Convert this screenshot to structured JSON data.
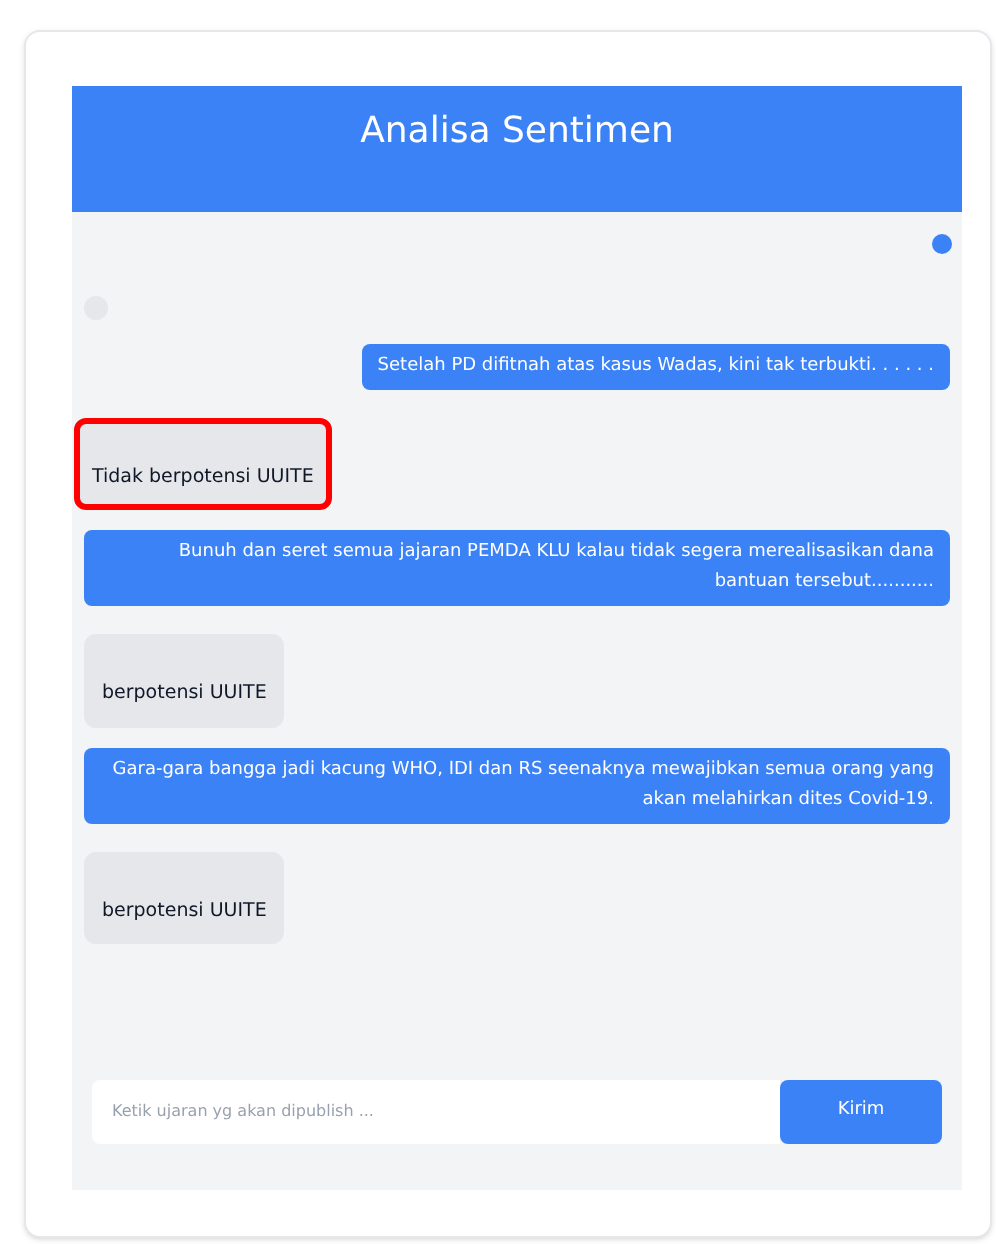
{
  "header": {
    "title": "Analisa Sentimen"
  },
  "messages": [
    {
      "kind": "sent",
      "text": "Setelah PD difitnah atas kasus Wadas, kini tak terbukti. . . . . ."
    },
    {
      "kind": "reply",
      "text": "Tidak berpotensi UUITE",
      "highlighted": true
    },
    {
      "kind": "sent",
      "text": "Bunuh dan seret semua jajaran PEMDA KLU kalau tidak segera merealisasikan dana bantuan tersebut..........."
    },
    {
      "kind": "reply",
      "text": "berpotensi UUITE",
      "highlighted": false
    },
    {
      "kind": "sent",
      "text": "Gara-gara bangga jadi kacung WHO, IDI dan RS seenaknya mewajibkan semua orang yang akan melahirkan dites Covid-19."
    },
    {
      "kind": "reply",
      "text": "berpotensi UUITE",
      "highlighted": false
    }
  ],
  "composer": {
    "placeholder": "Ketik ujaran yg akan dipublish ...",
    "button": "Kirim"
  }
}
